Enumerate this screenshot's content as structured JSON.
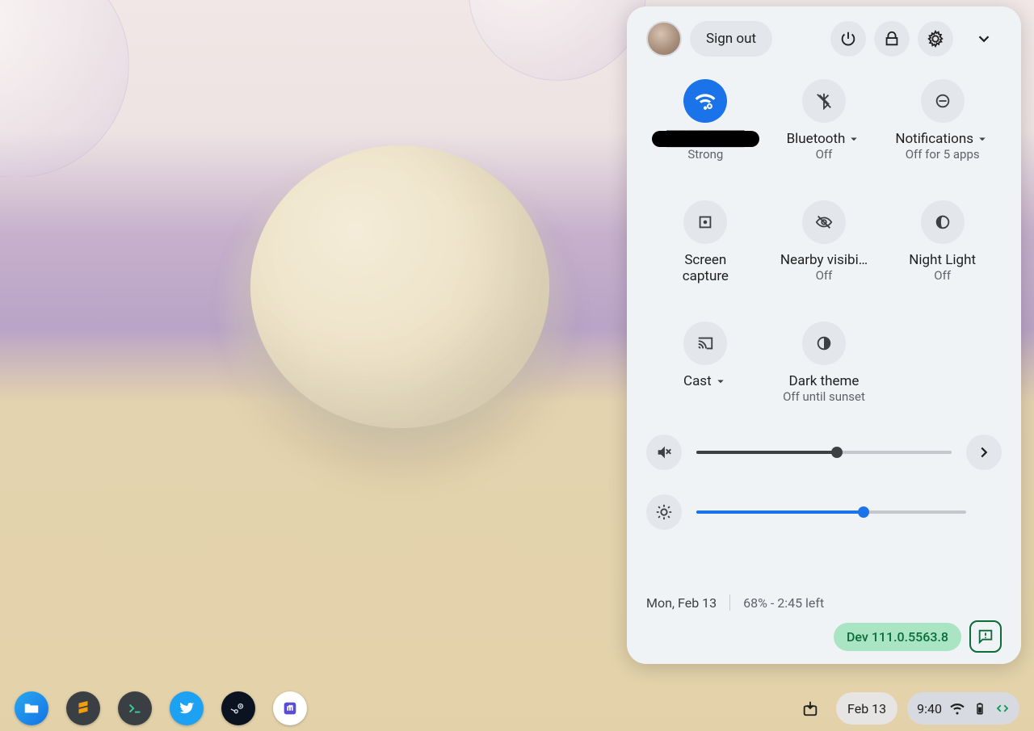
{
  "header": {
    "sign_out": "Sign out"
  },
  "tiles": {
    "wifi": {
      "label": "████████",
      "sub": "Strong"
    },
    "bluetooth": {
      "label": "Bluetooth",
      "sub": "Off"
    },
    "notifications": {
      "label": "Notifications",
      "sub": "Off for 5 apps"
    },
    "screen_capture": {
      "label1": "Screen",
      "label2": "capture"
    },
    "nearby": {
      "label": "Nearby visibi…",
      "sub": "Off"
    },
    "night_light": {
      "label": "Night Light",
      "sub": "Off"
    },
    "cast": {
      "label": "Cast"
    },
    "dark_theme": {
      "label": "Dark theme",
      "sub": "Off until sunset"
    }
  },
  "sliders": {
    "volume_percent": 55,
    "brightness_percent": 62
  },
  "footer": {
    "date": "Mon, Feb 13",
    "battery": "68% - 2:45 left",
    "dev_badge": "Dev 111.0.5563.8"
  },
  "shelf": {
    "date_btn": "Feb 13",
    "time": "9:40"
  },
  "colors": {
    "accent": "#1a73e8",
    "green": "#0b6b3a",
    "green_bg": "#a9e5c3"
  }
}
